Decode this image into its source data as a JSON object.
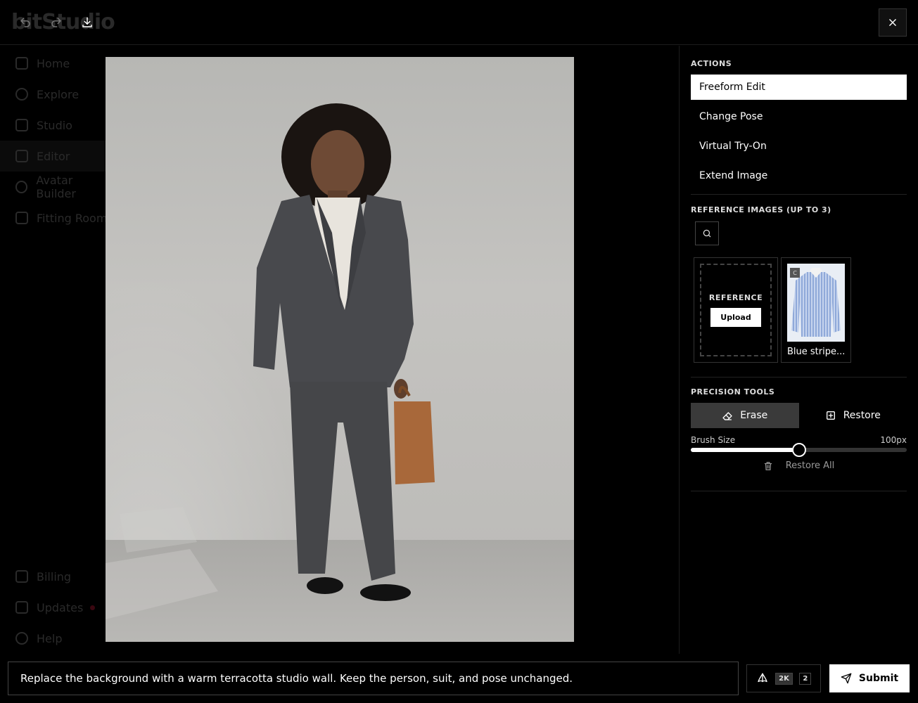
{
  "background_app": {
    "logo": "bitStudio",
    "nav_items": [
      {
        "label": "Home"
      },
      {
        "label": "Explore"
      },
      {
        "label": "Studio"
      },
      {
        "label": "Editor"
      },
      {
        "label": "Avatar Builder"
      },
      {
        "label": "Fitting Room"
      }
    ],
    "bottom_items": [
      {
        "label": "Billing"
      },
      {
        "label": "Updates"
      },
      {
        "label": "Help"
      }
    ]
  },
  "toolbar": {
    "undo_icon": "undo-icon",
    "redo_icon": "redo-icon",
    "download_icon": "download-icon",
    "close_icon": "close-icon"
  },
  "actions": {
    "title": "ACTIONS",
    "items": [
      {
        "label": "Freeform Edit",
        "selected": true
      },
      {
        "label": "Change Pose",
        "selected": false
      },
      {
        "label": "Virtual Try-On",
        "selected": false
      },
      {
        "label": "Extend Image",
        "selected": false
      }
    ]
  },
  "reference_images": {
    "title": "REFERENCE IMAGES (UP TO 3)",
    "upload_label": "REFERENCE",
    "upload_button": "Upload",
    "items": [
      {
        "caption": "Blue stripe...",
        "badge": "C"
      }
    ]
  },
  "precision_tools": {
    "title": "PRECISION TOOLS",
    "erase_label": "Erase",
    "restore_label": "Restore",
    "brush_label": "Brush Size",
    "brush_value_text": "100px",
    "brush_fraction": 0.5,
    "restore_all_label": "Restore All"
  },
  "prompt": {
    "value": "Replace the background with a warm terracotta studio wall. Keep the person, suit, and pose unchanged."
  },
  "options": {
    "resolution": "2K",
    "count": "2"
  },
  "submit": {
    "label": "Submit"
  },
  "colors": {
    "background": "#000000",
    "selected_action_bg": "#ffffff",
    "suit": "#4a4b4f",
    "bag": "#a8683a"
  }
}
